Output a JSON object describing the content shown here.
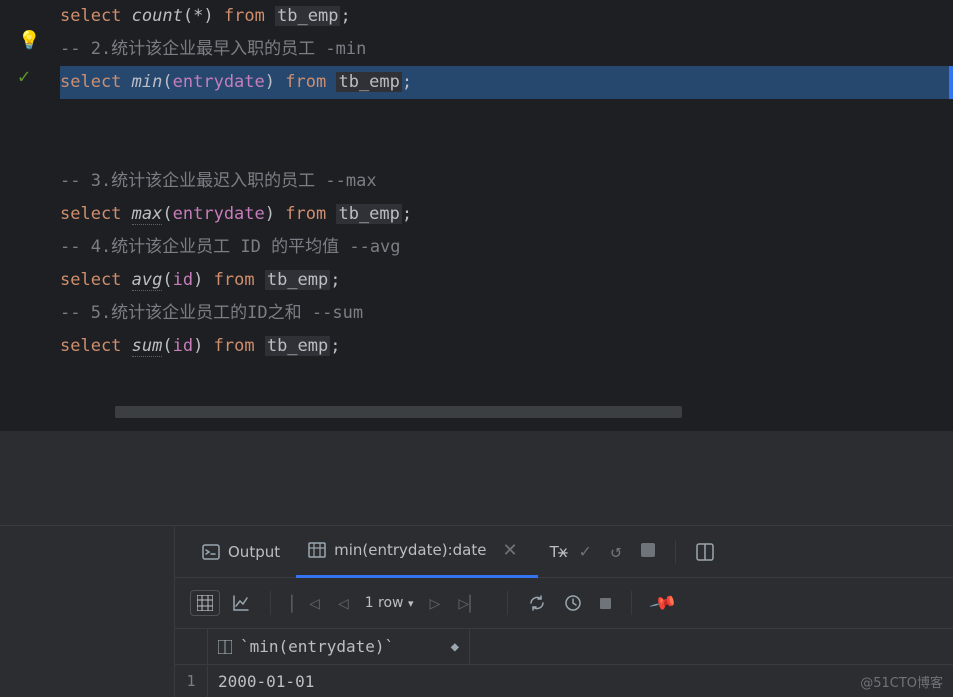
{
  "code": {
    "lines": [
      {
        "type": "sql",
        "tokens": [
          "select",
          " ",
          "count",
          "(",
          "*",
          ")",
          " ",
          "from",
          " ",
          "tb_emp",
          ";"
        ]
      },
      {
        "type": "comment",
        "text": "-- 2.统计该企业最早入职的员工 -min",
        "bulb": true
      },
      {
        "type": "sql",
        "highlight": true,
        "check": true,
        "tokens": [
          "select",
          " ",
          "min",
          "(",
          "entrydate",
          ")",
          " ",
          "from",
          " ",
          "tb_emp",
          ";"
        ]
      },
      {
        "type": "blank"
      },
      {
        "type": "blank"
      },
      {
        "type": "comment",
        "text": "-- 3.统计该企业最迟入职的员工 --max"
      },
      {
        "type": "sql",
        "tokens": [
          "select",
          " ",
          "max",
          "(",
          "entrydate",
          ")",
          " ",
          "from",
          " ",
          "tb_emp",
          ";"
        ]
      },
      {
        "type": "comment",
        "text": "-- 4.统计该企业员工 ID 的平均值 --avg"
      },
      {
        "type": "sql",
        "tokens": [
          "select",
          " ",
          "avg",
          "(",
          "id",
          ")",
          " ",
          "from",
          " ",
          "tb_emp",
          ";"
        ]
      },
      {
        "type": "comment",
        "text": "-- 5.统计该企业员工的ID之和 --sum"
      },
      {
        "type": "sql",
        "tokens": [
          "select",
          " ",
          "sum",
          "(",
          "id",
          ")",
          " ",
          "from",
          " ",
          "tb_emp",
          ";"
        ]
      }
    ]
  },
  "panel": {
    "tabs": {
      "output": "Output",
      "result": "min(entrydate):date"
    },
    "tx_label": "Tx̶",
    "toolbar": {
      "row_count": "1 row"
    },
    "grid": {
      "column": "`min(entrydate)`",
      "row_num": "1",
      "value": "2000-01-01"
    }
  },
  "watermark": "@51CTO博客"
}
